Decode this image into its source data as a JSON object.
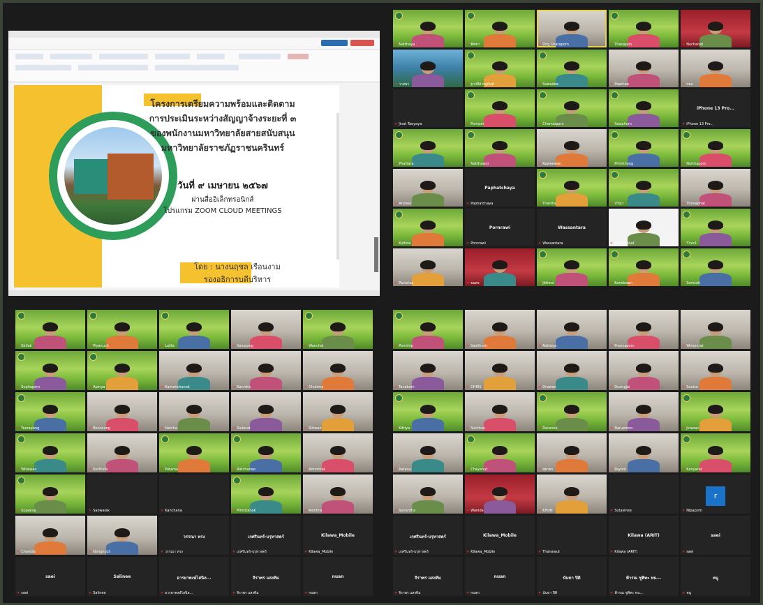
{
  "slide": {
    "title_lines": [
      "โครงการเตรียมความพร้อมและติดตาม",
      "การประเมินระหว่างสัญญาจ้างระยะที่ ๓",
      "ของพนักงานมหาวิทยาลัยสายสนับสนุน",
      "มหาวิทยาลัยราชภัฏราชนครินทร์"
    ],
    "date": "วันที่ ๙ เมษายน ๒๕๖๗",
    "via": "ผ่านสื่ออิเล็กทรอนิกส์",
    "program": "โปรแกรม ZOOM CLOUD MEETINGS",
    "by": "โดย : นางนฤชล เรือนงาม",
    "role": "รองอธิการบดีบริหาร"
  },
  "gallery_right": [
    {
      "name": "Natthaya",
      "bg": "green"
    },
    {
      "name": "พิชชา",
      "bg": "green"
    },
    {
      "name": "Ong Usaraporn",
      "bg": "office",
      "speaking": true
    },
    {
      "name": "Thanapon",
      "bg": "green"
    },
    {
      "name": "Nuchanat",
      "bg": "red"
    },
    {
      "name": "วาสนา",
      "bg": "sea"
    },
    {
      "name": "ฐาปนีย์ หนูนันท์",
      "bg": "green"
    },
    {
      "name": "Suwadee",
      "bg": "green"
    },
    {
      "name": "Pawinee",
      "bg": "office"
    },
    {
      "name": "กมล",
      "bg": "office"
    },
    {
      "name": "Jinat Taeyaya",
      "bg": "dark"
    },
    {
      "name": "Pornpat",
      "bg": "green"
    },
    {
      "name": "Chamaiporn",
      "bg": "green"
    },
    {
      "name": "Sasiphorn",
      "bg": "green"
    },
    {
      "name": "iPhone 13 Pro...",
      "bg": "dark",
      "center": "iPhone 13 Pro..."
    },
    {
      "name": "Phattara",
      "bg": "green"
    },
    {
      "name": "Natthawut",
      "bg": "green"
    },
    {
      "name": "Raweewan",
      "bg": "office"
    },
    {
      "name": "Phimthong",
      "bg": "green"
    },
    {
      "name": "Nutthaporn",
      "bg": "green"
    },
    {
      "name": "Arunee",
      "bg": "office"
    },
    {
      "name": "Paphatchaya",
      "bg": "dark",
      "center": "Paphatchaya"
    },
    {
      "name": "Thanita",
      "bg": "green"
    },
    {
      "name": "ปวีณา",
      "bg": "green"
    },
    {
      "name": "Thanaphat",
      "bg": "office"
    },
    {
      "name": "Kultida",
      "bg": "green"
    },
    {
      "name": "Pornrawi",
      "bg": "dark",
      "center": "Pornrawi"
    },
    {
      "name": "Wassantara",
      "bg": "dark",
      "center": "Wassantara"
    },
    {
      "name": "Natthaphat",
      "bg": "blue"
    },
    {
      "name": "วิโรจน์",
      "bg": "green"
    },
    {
      "name": "Pavarisa",
      "bg": "office"
    },
    {
      "name": "ธนพร",
      "bg": "red"
    },
    {
      "name": "Jittima",
      "bg": "green"
    },
    {
      "name": "Kanokwan",
      "bg": "green"
    },
    {
      "name": "Somsak",
      "bg": "green"
    }
  ],
  "gallery_bottom_left": [
    {
      "name": "Sirilak",
      "bg": "green"
    },
    {
      "name": "Piyanuch",
      "bg": "green"
    },
    {
      "name": "Lalita",
      "bg": "green"
    },
    {
      "name": "Sompong",
      "bg": "office"
    },
    {
      "name": "Wanchai",
      "bg": "green"
    },
    {
      "name": "Suphaporn",
      "bg": "green"
    },
    {
      "name": "Apinya",
      "bg": "green"
    },
    {
      "name": "Kamonchanok",
      "bg": "office"
    },
    {
      "name": "Kannika",
      "bg": "office"
    },
    {
      "name": "Chutima",
      "bg": "office"
    },
    {
      "name": "Teerapong",
      "bg": "green"
    },
    {
      "name": "Boonsong",
      "bg": "office"
    },
    {
      "name": "Natcha",
      "bg": "office"
    },
    {
      "name": "Sudarat",
      "bg": "office"
    },
    {
      "name": "Siriwan",
      "bg": "office"
    },
    {
      "name": "Wilaiwan",
      "bg": "green"
    },
    {
      "name": "Sutthida",
      "bg": "office"
    },
    {
      "name": "Patama",
      "bg": "green"
    },
    {
      "name": "Ratchanee",
      "bg": "green"
    },
    {
      "name": "Amornrat",
      "bg": "office"
    },
    {
      "name": "Supansa",
      "bg": "green"
    },
    {
      "name": "Saowalak",
      "bg": "dark"
    },
    {
      "name": "Kanchana",
      "bg": "dark"
    },
    {
      "name": "Pimchanok",
      "bg": "green"
    },
    {
      "name": "Montira",
      "bg": "office"
    },
    {
      "name": "Chanida",
      "bg": "office"
    },
    {
      "name": "Nongnuch",
      "bg": "office"
    },
    {
      "name": "วรรณา ทรง",
      "bg": "dark",
      "center": "วรรณา ทรง"
    },
    {
      "name": "เกศรินทร์-บรุทาสตร์",
      "bg": "dark",
      "center": "เกศรินทร์-บรุทาสตร์"
    },
    {
      "name": "Kilawa_Mobile",
      "bg": "dark",
      "center": "Kilawa_Mobile"
    },
    {
      "name": "saei",
      "bg": "dark",
      "center": "saei"
    },
    {
      "name": "Salinee",
      "bg": "dark",
      "center": "Salinee"
    },
    {
      "name": "อารยาพงษ์ไสนิล...",
      "bg": "dark",
      "center": "อารยาพงษ์ไสนิล..."
    },
    {
      "name": "จิราพร แสงทิม",
      "bg": "dark",
      "center": "จิราพร แสงทิม"
    },
    {
      "name": "nuan",
      "bg": "dark",
      "center": "nuan"
    }
  ],
  "gallery_bottom_right": [
    {
      "name": "Pornthip",
      "bg": "green"
    },
    {
      "name": "Sasithorn",
      "bg": "office"
    },
    {
      "name": "Nattaya",
      "bg": "office"
    },
    {
      "name": "Preeyaporn",
      "bg": "office"
    },
    {
      "name": "Wimonrat",
      "bg": "office"
    },
    {
      "name": "Tanakorn",
      "bg": "office"
    },
    {
      "name": "CHRIS",
      "bg": "office"
    },
    {
      "name": "Orawan",
      "bg": "office"
    },
    {
      "name": "Duangjai",
      "bg": "office"
    },
    {
      "name": "Sunisa",
      "bg": "office"
    },
    {
      "name": "Kittiya",
      "bg": "green"
    },
    {
      "name": "Sunthon",
      "bg": "office"
    },
    {
      "name": "Daranee",
      "bg": "green"
    },
    {
      "name": "Naruemon",
      "bg": "office"
    },
    {
      "name": "Jirawan",
      "bg": "green"
    },
    {
      "name": "Ratana",
      "bg": "office"
    },
    {
      "name": "Chayanut",
      "bg": "green"
    },
    {
      "name": "ยุพาพร",
      "bg": "office"
    },
    {
      "name": "Payom",
      "bg": "office"
    },
    {
      "name": "Kanyarat",
      "bg": "green"
    },
    {
      "name": "Sunantha",
      "bg": "office"
    },
    {
      "name": "Wanida",
      "bg": "red"
    },
    {
      "name": "KHUN",
      "bg": "office"
    },
    {
      "name": "Sutasinee",
      "bg": "dark"
    },
    {
      "name": "Nipaporn",
      "bg": "dark",
      "square": "r"
    },
    {
      "name": "เกศรินทร์-บรุทาสตร์",
      "bg": "dark",
      "center": "เกศรินทร์-บรุทาสตร์"
    },
    {
      "name": "Kilawa_Mobile",
      "bg": "dark",
      "center": "Kilawa_Mobile"
    },
    {
      "name": "Thanawut",
      "bg": "dark"
    },
    {
      "name": "Kilawa (ARIT)",
      "bg": "dark",
      "center": "Kilawa (ARIT)"
    },
    {
      "name": "saei",
      "bg": "dark",
      "center": "saei"
    },
    {
      "name": "จิราพร แสงทิม",
      "bg": "dark",
      "center": "จิราพร แสงทิม"
    },
    {
      "name": "nuan",
      "bg": "dark",
      "center": "nuan"
    },
    {
      "name": "นันทา ปิติ",
      "bg": "dark",
      "center": "นันทา ปิติ"
    },
    {
      "name": "ฟ้ารณ ชูพิทะ ทน...",
      "bg": "dark",
      "center": "ฟ้ารณ ชูพิทะ ทน..."
    },
    {
      "name": "หนู",
      "bg": "dark",
      "center": "หนู"
    }
  ],
  "colors": {
    "accent_yellow": "#f6c12e",
    "accent_green": "#2e9d5a",
    "muted_mic": "#ff3b30",
    "speaker_border": "#e9d24b"
  }
}
